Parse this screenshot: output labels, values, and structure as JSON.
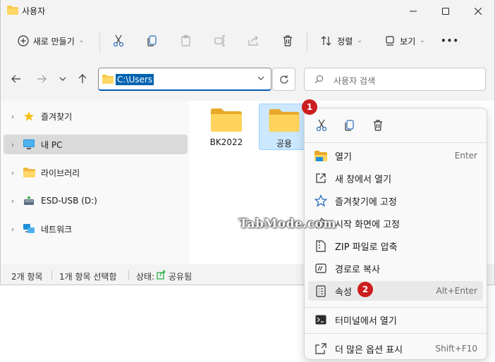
{
  "window": {
    "title": "사용자"
  },
  "toolbar": {
    "new_label": "새로 만들기",
    "sort_label": "정렬",
    "view_label": "보기",
    "more": "•••"
  },
  "navigation": {
    "address": "C:\\Users",
    "search_placeholder": "사용자 검색"
  },
  "sidebar": {
    "items": [
      {
        "label": "즐겨찾기",
        "icon": "star-icon"
      },
      {
        "label": "내 PC",
        "icon": "pc-icon",
        "selected": true
      },
      {
        "label": "라이브러리",
        "icon": "library-icon"
      },
      {
        "label": "ESD-USB (D:)",
        "icon": "usb-drive-icon"
      },
      {
        "label": "네트워크",
        "icon": "network-icon"
      }
    ]
  },
  "files": [
    {
      "name": "BK2022",
      "selected": false
    },
    {
      "name": "공용",
      "selected": true
    }
  ],
  "status": {
    "count": "2개 항목",
    "selected": "1개 항목 선택함",
    "state_label": "상태:",
    "state_value": "공유됨"
  },
  "context_menu": {
    "items": [
      {
        "label": "열기",
        "shortcut": "Enter",
        "icon": "open-folder-icon"
      },
      {
        "label": "새 창에서 열기",
        "shortcut": "",
        "icon": "new-window-icon"
      },
      {
        "label": "즐겨찾기에 고정",
        "shortcut": "",
        "icon": "star-outline-icon"
      },
      {
        "label": "시작 화면에 고정",
        "shortcut": "",
        "icon": "pin-icon"
      },
      {
        "label": "ZIP 파일로 압축",
        "shortcut": "",
        "icon": "zip-icon"
      },
      {
        "label": "경로로 복사",
        "shortcut": "",
        "icon": "copy-path-icon"
      },
      {
        "label": "속성",
        "shortcut": "Alt+Enter",
        "icon": "properties-icon",
        "hover": true
      },
      {
        "label": "터미널에서 열기",
        "shortcut": "",
        "icon": "terminal-icon"
      },
      {
        "label": "더 많은 옵션 표시",
        "shortcut": "Shift+F10",
        "icon": "more-options-icon"
      }
    ]
  },
  "badges": {
    "first": "1",
    "second": "2"
  },
  "watermark": "TabMode.com",
  "colors": {
    "accent": "#005fb8",
    "selection": "#cce8ff",
    "folder": "#f8c94a",
    "badge": "#cc1e1e"
  }
}
